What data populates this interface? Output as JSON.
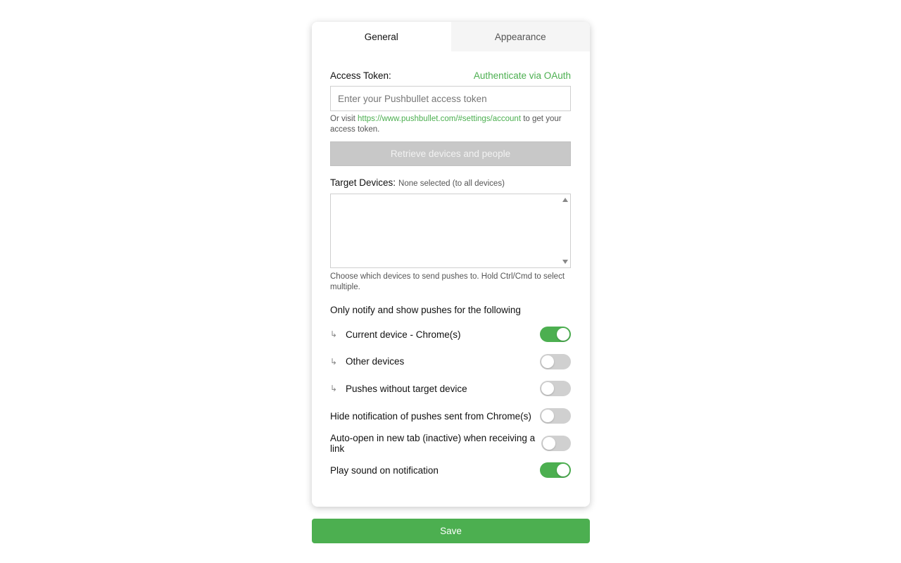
{
  "tabs": [
    {
      "label": "General",
      "active": true
    },
    {
      "label": "Appearance",
      "active": false
    }
  ],
  "access_token": {
    "label": "Access Token:",
    "oauth_link": "Authenticate via OAuth",
    "placeholder": "Enter your Pushbullet access token",
    "value": "",
    "hint_prefix": "Or visit ",
    "hint_link": "https://www.pushbullet.com/#settings/account",
    "hint_suffix": " to get your access token."
  },
  "retrieve_button": "Retrieve devices and people",
  "target_devices": {
    "label": "Target Devices:",
    "status": "None selected (to all devices)",
    "options": [],
    "hint": "Choose which devices to send pushes to. Hold Ctrl/Cmd to select multiple."
  },
  "notify_section_title": "Only notify and show pushes for the following",
  "toggles": [
    {
      "label": "Current device - Chrome(s)",
      "sub": true,
      "on": true
    },
    {
      "label": "Other devices",
      "sub": true,
      "on": false
    },
    {
      "label": "Pushes without target device",
      "sub": true,
      "on": false
    },
    {
      "label": "Hide notification of pushes sent from Chrome(s)",
      "sub": false,
      "on": false
    },
    {
      "label": "Auto-open in new tab (inactive) when receiving a link",
      "sub": false,
      "on": false
    },
    {
      "label": "Play sound on notification",
      "sub": false,
      "on": true
    }
  ],
  "sub_arrow": "↳",
  "save_button": "Save",
  "colors": {
    "accent": "#4caf50",
    "toggle_off": "#d0d0d0",
    "disabled_button": "#c8c8c8"
  }
}
